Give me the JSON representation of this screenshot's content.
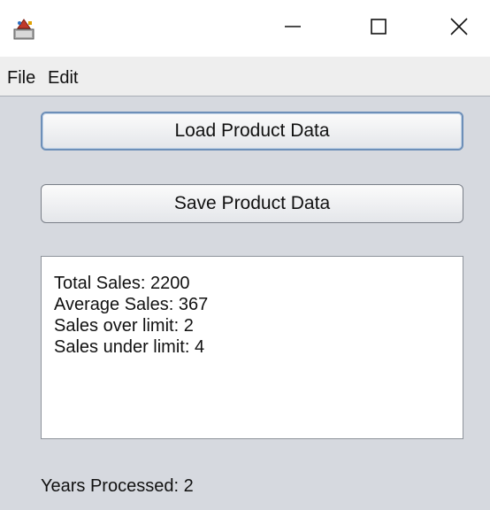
{
  "window": {
    "icon": "java-app-icon",
    "controls": {
      "minimize": "minimize-icon",
      "maximize": "maximize-icon",
      "close": "close-icon"
    }
  },
  "menubar": {
    "items": [
      {
        "label": "File"
      },
      {
        "label": "Edit"
      }
    ]
  },
  "buttons": {
    "load_label": "Load Product Data",
    "save_label": "Save Product Data"
  },
  "results": {
    "lines": [
      "Total Sales: 2200",
      "Average Sales: 367",
      "Sales over limit: 2",
      "Sales under limit: 4"
    ]
  },
  "status": {
    "years_processed": "Years Processed: 2"
  },
  "colors": {
    "content_background": "#d6d9df",
    "focus_border": "#6d8fb8"
  }
}
